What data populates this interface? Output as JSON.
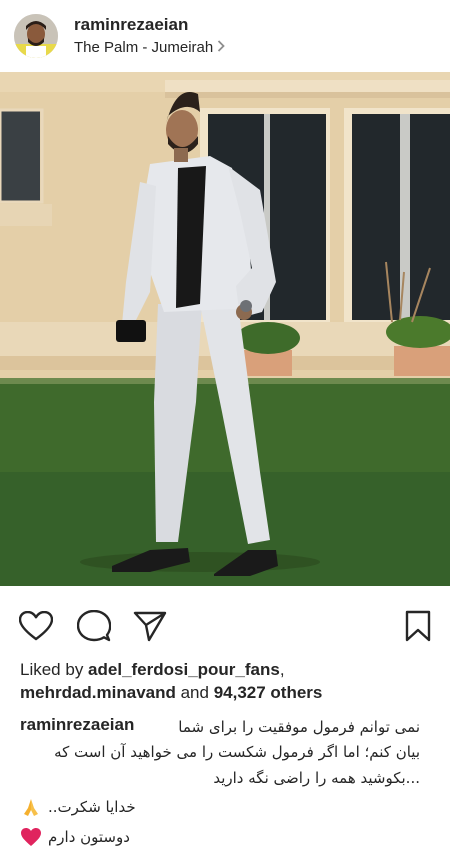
{
  "post": {
    "username": "raminrezaeian",
    "location": "The Palm - Jumeirah"
  },
  "icons": {
    "avatar": "profile-avatar",
    "location_chevron": "chevron-right-icon",
    "like": "heart-outline-icon",
    "comment": "comment-bubble-icon",
    "share": "paper-plane-icon",
    "save": "bookmark-icon"
  },
  "likes": {
    "prefix": "Liked by ",
    "user1": "adel_ferdosi_pour_fans",
    "separator": ",",
    "user2": "mehrdad.minavand",
    "and_text": " and ",
    "count": "94,327 others"
  },
  "caption": {
    "username": "raminrezaeian",
    "line1": "نمی توانم فرمول موفقیت را برای شما",
    "line2": "بیان کنم؛ اما اگر فرمول شکست را می خواهید آن است که",
    "line3": "...بکوشید همه را راضی نگه دارید",
    "line4": "خدایا شکرت..",
    "line5": "دوستون دارم"
  },
  "colors": {
    "text": "#262626",
    "heart_red": "#e0245e",
    "pray_yellow": "#f5b02e"
  }
}
